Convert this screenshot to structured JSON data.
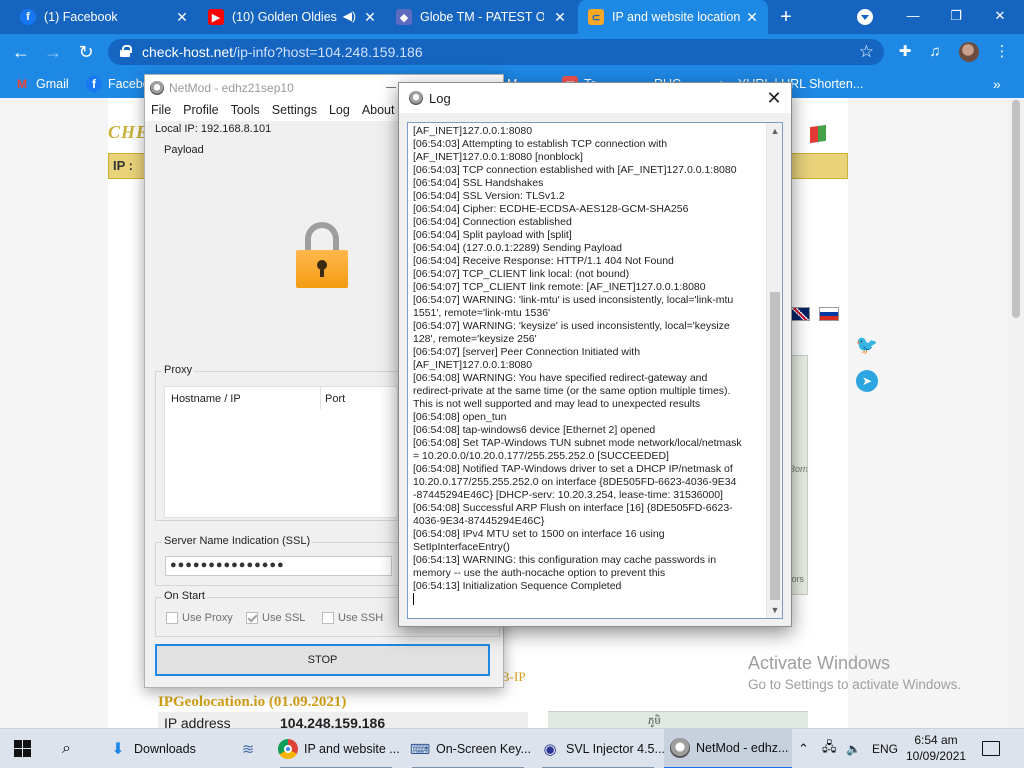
{
  "browser": {
    "tabs": [
      {
        "title": "(1) Facebook",
        "icon": "facebook-icon",
        "color": "#1877f2"
      },
      {
        "title": "(10) Golden Oldies",
        "icon": "youtube-icon",
        "color": "#ff0000"
      },
      {
        "title": "Globe TM - PATEST OV",
        "icon": "globe-icon",
        "color": "#5c6bc0"
      },
      {
        "title": "IP and website location",
        "icon": "checkhost-icon",
        "color": "#f9a825"
      }
    ],
    "url_host": "check-host.net",
    "url_path": "/ip-info?host=104.248.159.186"
  },
  "bookmarks": {
    "gmail": "Gmail",
    "facebook": "Facebo",
    "m": "M",
    "tr": "Tr",
    "ruc": "RUC",
    "yurl": "YURL | URL Shorten..."
  },
  "netmod": {
    "title": "NetMod - edhz21sep10",
    "menu": [
      "File",
      "Profile",
      "Tools",
      "Settings",
      "Log",
      "About"
    ],
    "local_ip": "Local IP: 192.168.8.101",
    "payload_label": "Payload",
    "proxy_label": "Proxy",
    "col_host": "Hostname / IP",
    "col_port": "Port",
    "sni_label": "Server Name Indication (SSL)",
    "sni_value": "●●●●●●●●●●●●●●●",
    "onstart_label": "On Start",
    "use_proxy": "Use Proxy",
    "use_ssl": "Use SSL",
    "use_ssh": "Use SSH",
    "use_proxy_checked": false,
    "use_ssl_checked": true,
    "use_ssh_checked": false,
    "stop_button": "STOP"
  },
  "log": {
    "title": "Log",
    "lines": [
      "[AF_INET]127.0.0.1:8080",
      "[06:54:03] Attempting to establish TCP connection with",
      "[AF_INET]127.0.0.1:8080 [nonblock]",
      "[06:54:03] TCP connection established with [AF_INET]127.0.0.1:8080",
      "[06:54:04] SSL Handshakes",
      "[06:54:04] SSL Version: TLSv1.2",
      "[06:54:04] Cipher: ECDHE-ECDSA-AES128-GCM-SHA256",
      "[06:54:04] Connection established",
      "[06:54:04] Split payload with [split]",
      "[06:54:04] (127.0.0.1:2289) Sending Payload",
      "[06:54:04] Receive Response: HTTP/1.1 404 Not Found",
      "[06:54:07] TCP_CLIENT link local: (not bound)",
      "[06:54:07] TCP_CLIENT link remote: [AF_INET]127.0.0.1:8080",
      "[06:54:07] WARNING: 'link-mtu' is used inconsistently, local='link-mtu",
      "1551', remote='link-mtu 1536'",
      "[06:54:07] WARNING: 'keysize' is used inconsistently, local='keysize",
      "128', remote='keysize 256'",
      "[06:54:07] [server] Peer Connection Initiated with",
      "[AF_INET]127.0.0.1:8080",
      "[06:54:08] WARNING: You have specified redirect-gateway and",
      "redirect-private at the same time (or the same option multiple times).",
      "This is not well supported and may lead to unexpected results",
      "[06:54:08] open_tun",
      "[06:54:08] tap-windows6 device [Ethernet 2] opened",
      "[06:54:08] Set TAP-Windows TUN subnet mode network/local/netmask",
      "= 10.20.0.0/10.20.0.177/255.255.252.0 [SUCCEEDED]",
      "[06:54:08] Notified TAP-Windows driver to set a DHCP IP/netmask of",
      "10.20.0.177/255.255.252.0 on interface {8DE505FD-6623-4036-9E34",
      "-87445294E46C} [DHCP-serv: 10.20.3.254, lease-time: 31536000]",
      "[06:54:08] Successful ARP Flush on interface [16] {8DE505FD-6623-",
      "4036-9E34-87445294E46C}",
      "[06:54:08] IPv4 MTU set to 1500 on interface 16 using",
      "SetIpInterfaceEntry()",
      "[06:54:13] WARNING: this configuration may cache passwords in",
      "memory -- use the auth-nocache option to prevent this",
      "[06:54:13] Initialization Sequence Completed"
    ]
  },
  "page": {
    "logo": "CHE",
    "ip_label": "IP :",
    "section_title": "IPGeolocation.io (01.09.2021)",
    "section_title2": "B-IP",
    "ip_address_label": "IP address",
    "ip_address_value": "104.248.159.186",
    "map_label1": "Born",
    "map_label2": "tors",
    "map2_label": "ភូមិ"
  },
  "activation": {
    "title": "Activate Windows",
    "subtitle": "Go to Settings to activate Windows."
  },
  "taskbar": {
    "items": [
      {
        "label": "Downloads"
      },
      {
        "label": ""
      },
      {
        "label": "IP and website ..."
      },
      {
        "label": "On-Screen Key..."
      },
      {
        "label": "SVL Injector 4.5..."
      },
      {
        "label": "NetMod - edhz..."
      }
    ],
    "lang": "ENG",
    "time": "6:54 am",
    "date": "10/09/2021"
  }
}
